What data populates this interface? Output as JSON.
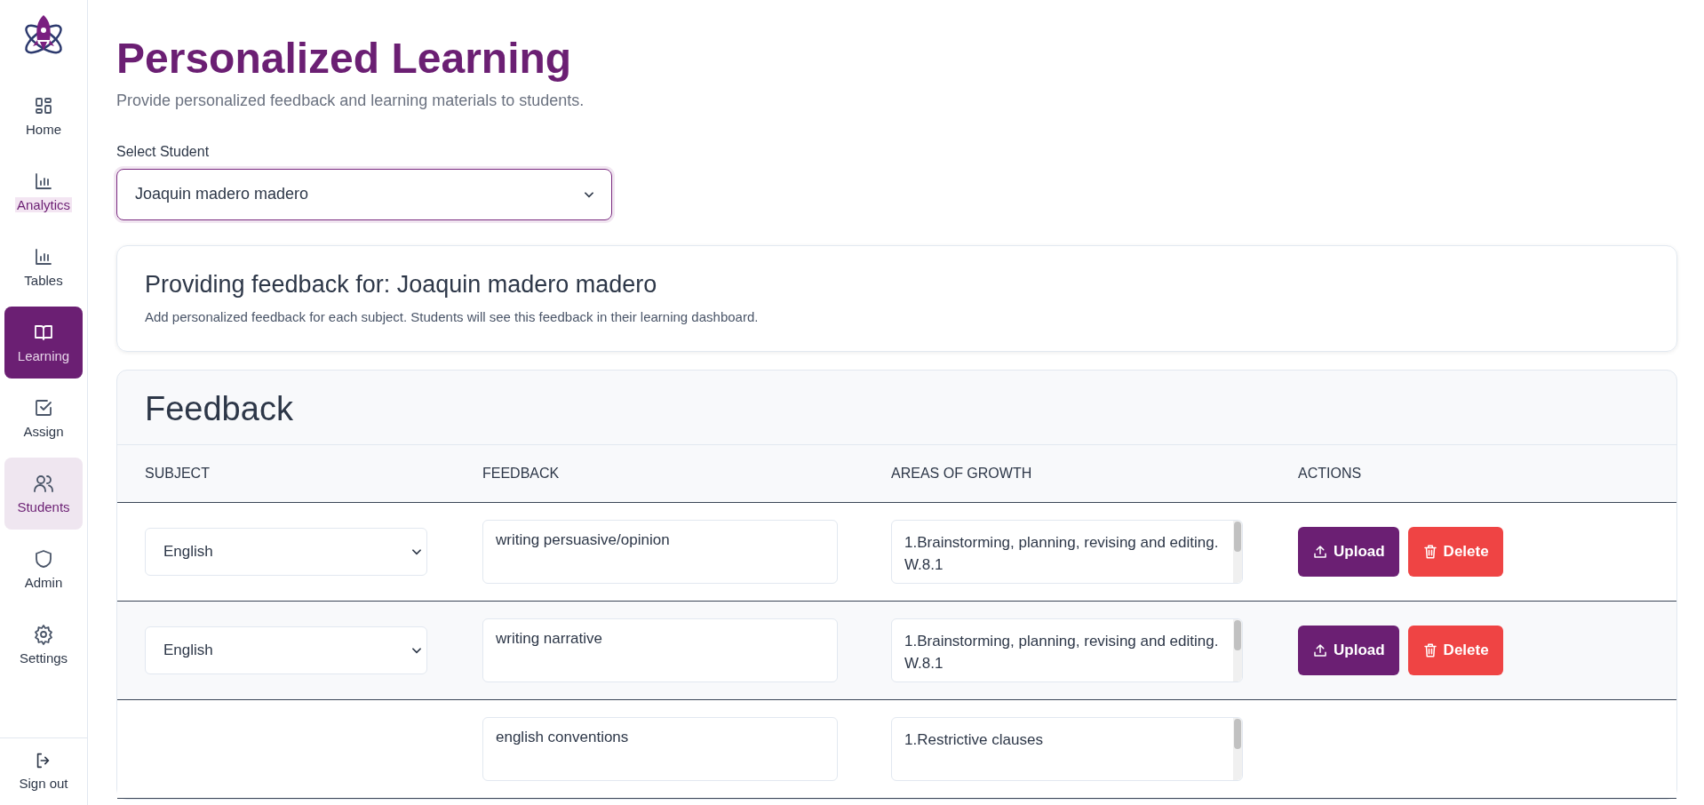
{
  "sidebar": {
    "items": [
      {
        "label": "Home",
        "selected": false,
        "hover": false,
        "marked": false
      },
      {
        "label": "Analytics",
        "selected": false,
        "hover": false,
        "marked": true
      },
      {
        "label": "Tables",
        "selected": false,
        "hover": false,
        "marked": false
      },
      {
        "label": "Learning",
        "selected": true,
        "hover": false,
        "marked": false
      },
      {
        "label": "Assign",
        "selected": false,
        "hover": false,
        "marked": false
      },
      {
        "label": "Students",
        "selected": false,
        "hover": true,
        "marked": false
      },
      {
        "label": "Admin",
        "selected": false,
        "hover": false,
        "marked": false
      },
      {
        "label": "Settings",
        "selected": false,
        "hover": false,
        "marked": false
      }
    ],
    "footer": {
      "label": "Sign out"
    }
  },
  "header": {
    "title": "Personalized Learning",
    "subtitle": "Provide personalized feedback and learning materials to students."
  },
  "student_select": {
    "label": "Select Student",
    "value": "Joaquin madero madero"
  },
  "info_card": {
    "title": "Providing feedback for: Joaquin madero madero",
    "description": "Add personalized feedback for each subject. Students will see this feedback in their learning dashboard."
  },
  "feedback_table": {
    "title": "Feedback",
    "columns": [
      "SUBJECT",
      "FEEDBACK",
      "AREAS OF GROWTH",
      "ACTIONS"
    ],
    "rows": [
      {
        "subject": "English",
        "feedback": "writing persuasive/opinion",
        "areas": "1.Brainstorming, planning, revising and editing. W.8.1",
        "actions": [
          "Upload",
          "Delete"
        ]
      },
      {
        "subject": "English",
        "feedback": "writing narrative",
        "areas": "1.Brainstorming, planning, revising and editing. W.8.1",
        "actions": [
          "Upload",
          "Delete"
        ]
      },
      {
        "feedback": "english conventions",
        "areas": "1.Restrictive clauses"
      }
    ]
  }
}
